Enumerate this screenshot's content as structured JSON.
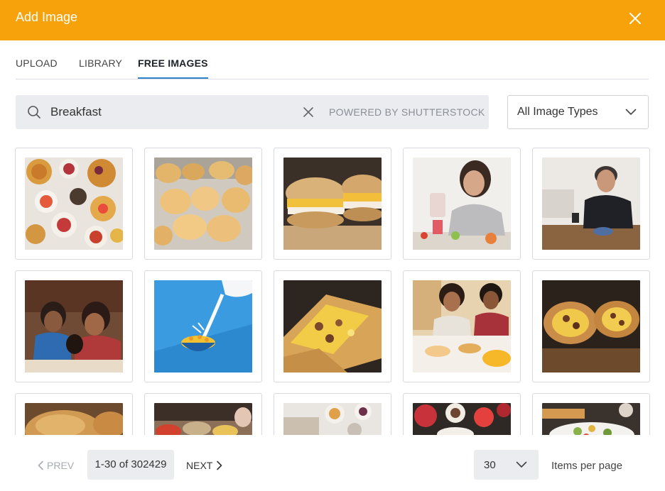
{
  "dialog": {
    "title": "Add Image"
  },
  "tabs": [
    {
      "label": "UPLOAD",
      "active": false
    },
    {
      "label": "LIBRARY",
      "active": false
    },
    {
      "label": "FREE IMAGES",
      "active": true
    }
  ],
  "search": {
    "value": "Breakfast",
    "powered_by": "POWERED BY SHUTTERSTOCK"
  },
  "filter": {
    "selected": "All Image Types"
  },
  "images": [
    "breakfast-spread-pancakes-waffles",
    "cheese-bread-rolls",
    "breakfast-sandwiches-egg-cheese",
    "woman-pouring-smoothie",
    "man-eating-cereal-with-phone",
    "family-eating-breakfast",
    "milk-pouring-into-cereal",
    "breakfast-tacos",
    "friends-breakfast-table",
    "breakfast-burritos",
    "croissant-pastry",
    "buffet-food-trays",
    "breakfast-table-top-view",
    "fruit-and-pastries-table",
    "salad-plate"
  ],
  "pagination": {
    "prev": "PREV",
    "range": "1-30 of 302429",
    "next": "NEXT",
    "per_page": "30",
    "per_page_label": "Items per page"
  },
  "colors": {
    "header": "#f7a20b",
    "active_tab_underline": "#2e83c8"
  }
}
